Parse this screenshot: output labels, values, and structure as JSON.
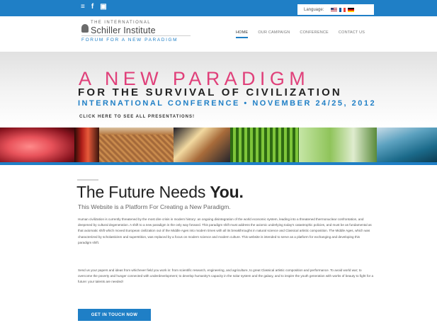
{
  "topbar": {
    "social_icons": [
      "rss-icon",
      "facebook-icon",
      "youtube-icon"
    ],
    "social_glyphs": [
      "≡",
      "f",
      "▣"
    ],
    "language_label": "Language:",
    "flags": [
      "us-flag-icon",
      "france-flag-icon",
      "germany-flag-icon"
    ],
    "accent_color": "#1f7fc6"
  },
  "header": {
    "logo_small": "THE INTERNATIONAL",
    "logo_name": "Schiller Institute",
    "logo_tagline": "FORUM FOR A NEW PARADIGM"
  },
  "nav": {
    "items": [
      {
        "label": "HOME",
        "active": true
      },
      {
        "label": "OUR CAMPAIGN",
        "active": false
      },
      {
        "label": "CONFERENCE",
        "active": false
      },
      {
        "label": "CONTACT US",
        "active": false
      }
    ]
  },
  "hero": {
    "headline": "A NEW PARADIGM",
    "subheadline": "FOR THE SURVIVAL OF CIVILIZATION",
    "conference": "INTERNATIONAL CONFERENCE • NOVEMBER 24/25, 2012",
    "link": "CLICK HERE TO SEE ALL PRESENTATIONS!",
    "headline_color": "#e0407a"
  },
  "main": {
    "title_prefix": "The Future Needs ",
    "title_bold": "You.",
    "subtitle": "This Website is a Platform For Creating a New Paradigm.",
    "paragraph1": "Human civilization is currently threatened by the most dire crisis in modern history: an ongoing disintegration of the world economic system, leading into a threatened thermonuclear confrontation, and deepened by cultural degeneration. A shift to a new paradigm is the only way forward. This paradigm shift must address the axiomic underlying today's catastrophic policies, and must be as fundamental as that axiomatic shift which moved European civilization out of the Middle Ages into modern times with all its breakthroughs in natural science and Classical artistic composition. The Middle Ages, which was characterized by scholasticism and superstition, was replaced by a focus on modern science and modern culture. This website is intended to serve as a platform for exchanging and developing this paradigm shift.",
    "paragraph2": "Send us your papers and ideas from whichever field you work in: from scientific research, engineering, and agriculture, to great Classical artistic composition and performance. To avoid world war; to overcome the poverty and hunger connected with underdevelopment; to develop humanity's capacity in the solar system and the galaxy, and to inspire the youth generation with works of beauty to fight for a future: your talents are needed!",
    "cta_label": "GET IN TOUCH NOW"
  }
}
